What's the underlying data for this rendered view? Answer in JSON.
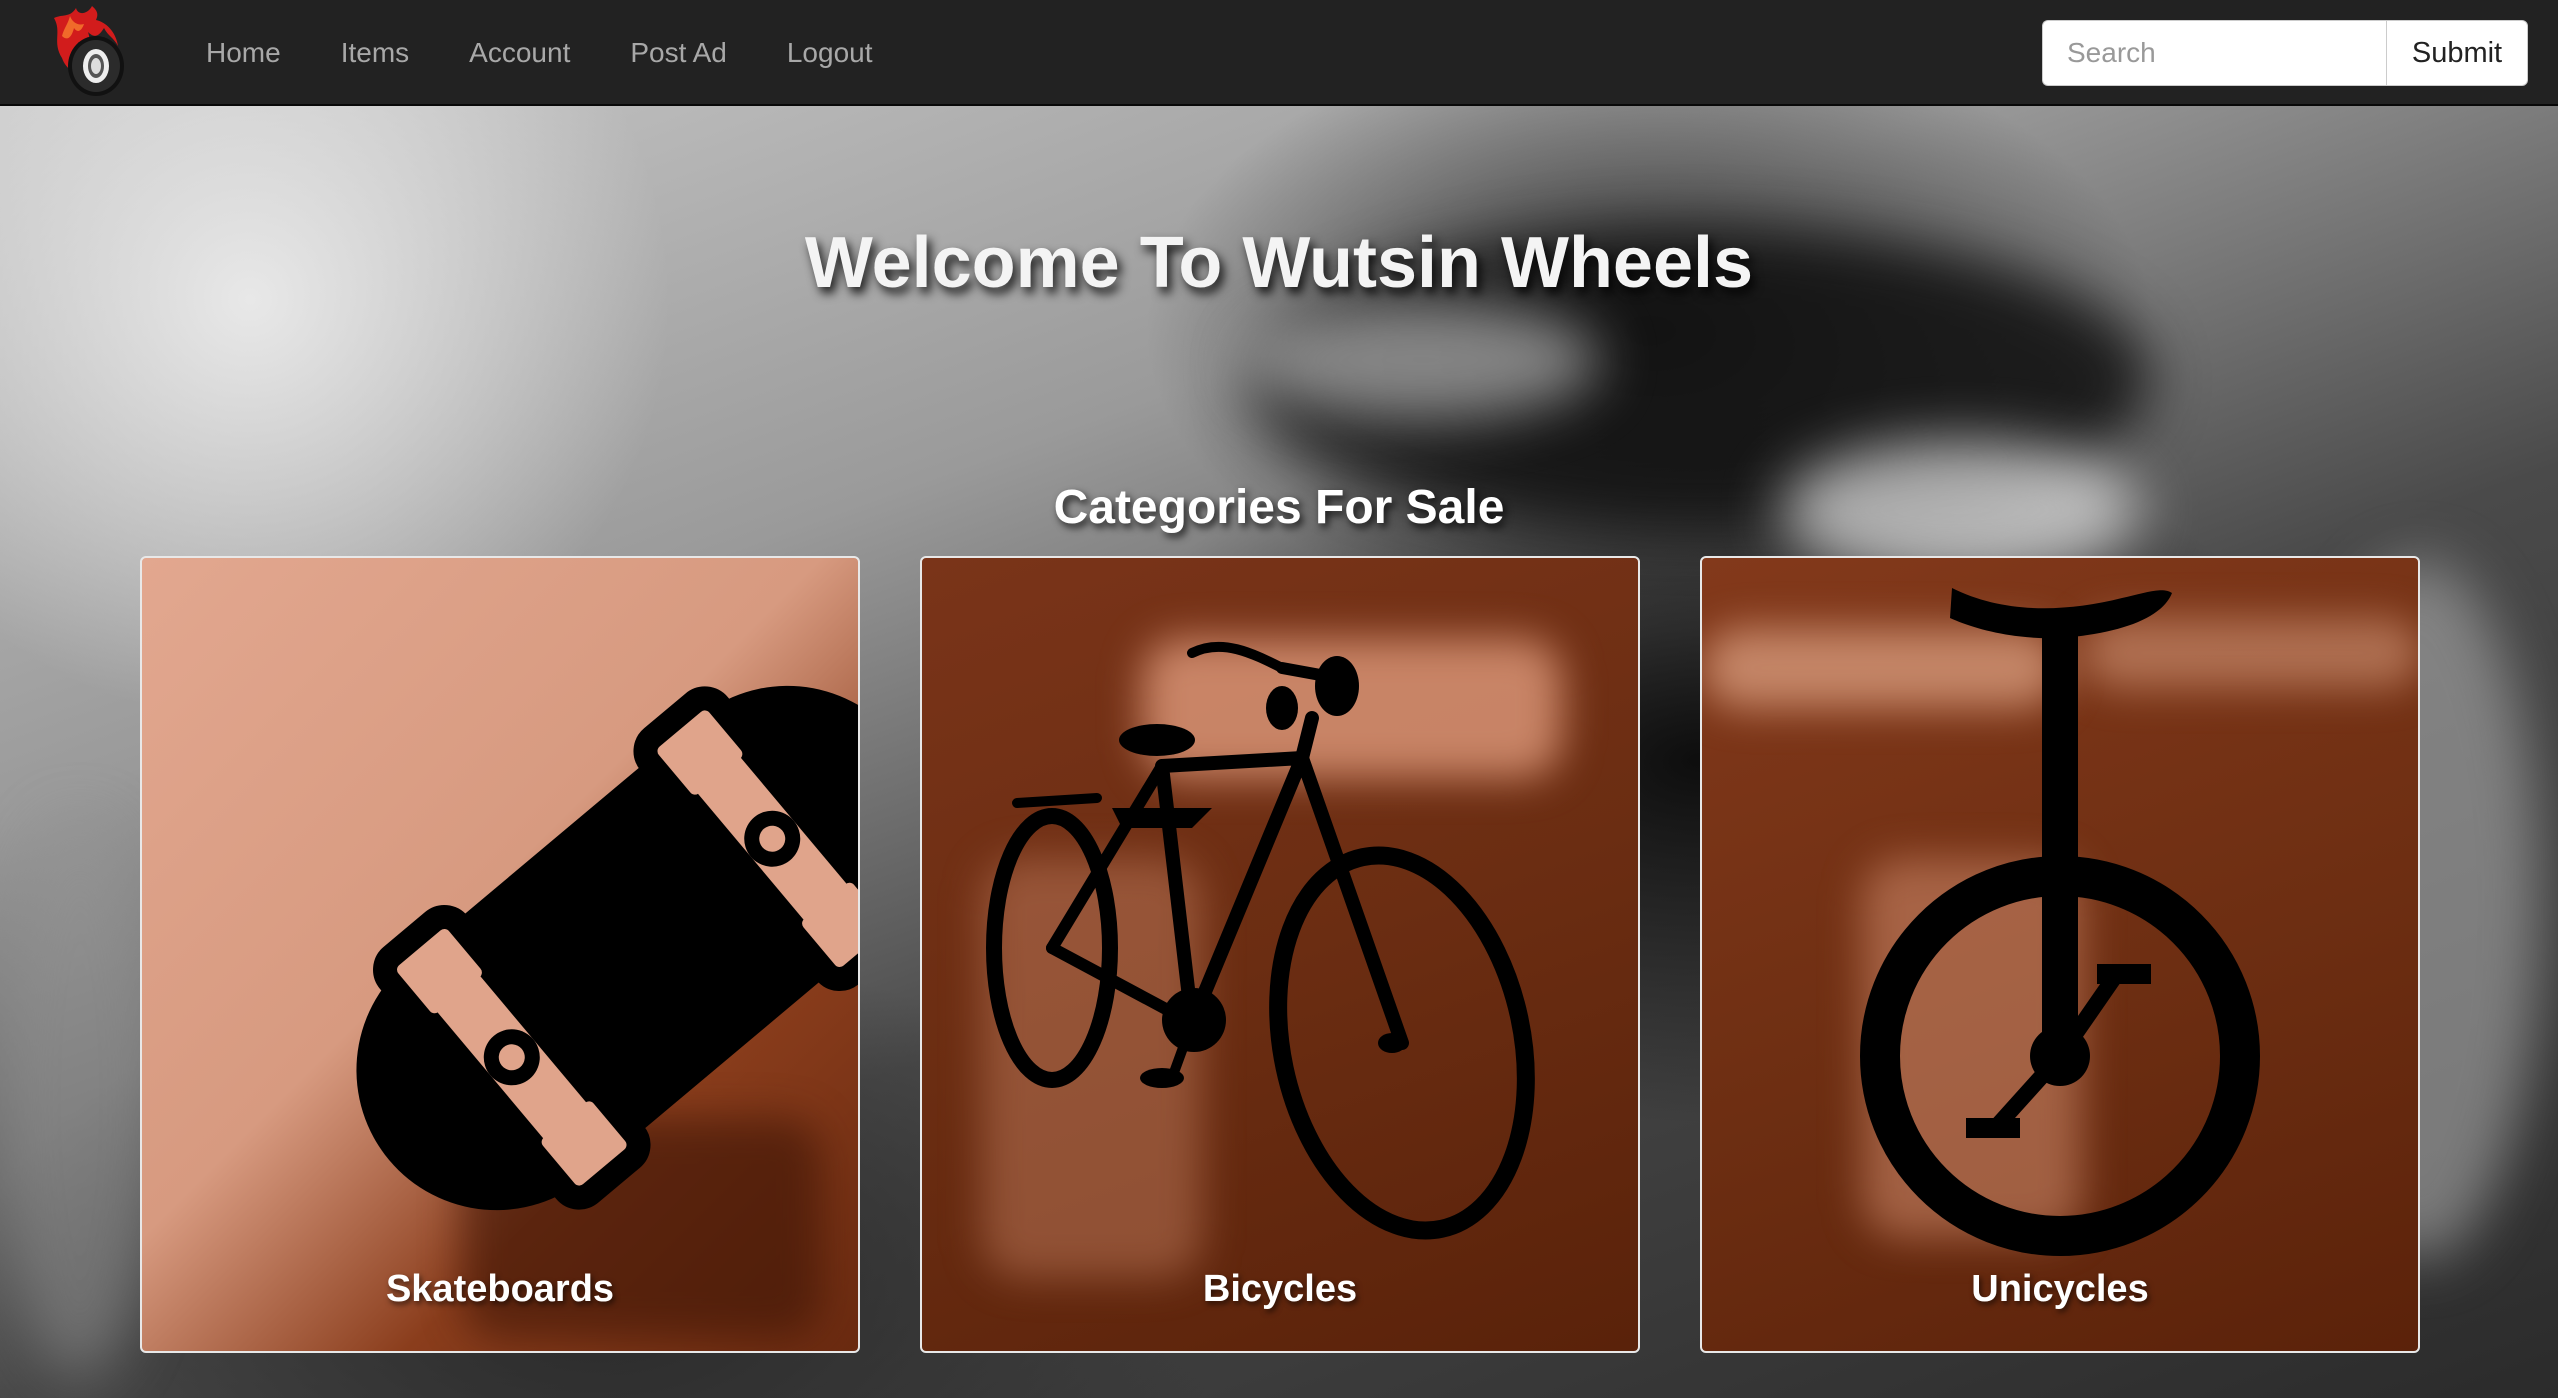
{
  "navbar": {
    "brand_icon": "flaming-wheel-logo",
    "links": [
      {
        "label": "Home"
      },
      {
        "label": "Items"
      },
      {
        "label": "Account"
      },
      {
        "label": "Post Ad"
      },
      {
        "label": "Logout"
      }
    ],
    "search": {
      "placeholder": "Search",
      "value": ""
    },
    "submit_label": "Submit"
  },
  "hero": {
    "title": "Welcome To Wutsin Wheels"
  },
  "categories": {
    "title": "Categories For Sale",
    "items": [
      {
        "label": "Skateboards",
        "icon": "skateboard-icon"
      },
      {
        "label": "Bicycles",
        "icon": "bicycle-icon"
      },
      {
        "label": "Unicycles",
        "icon": "unicycle-icon"
      }
    ]
  },
  "colors": {
    "navbar_bg": "#222222",
    "nav_link": "#a8a8a8",
    "card_tone": "#6b2d12",
    "card_light_tone": "#e2a78f"
  }
}
